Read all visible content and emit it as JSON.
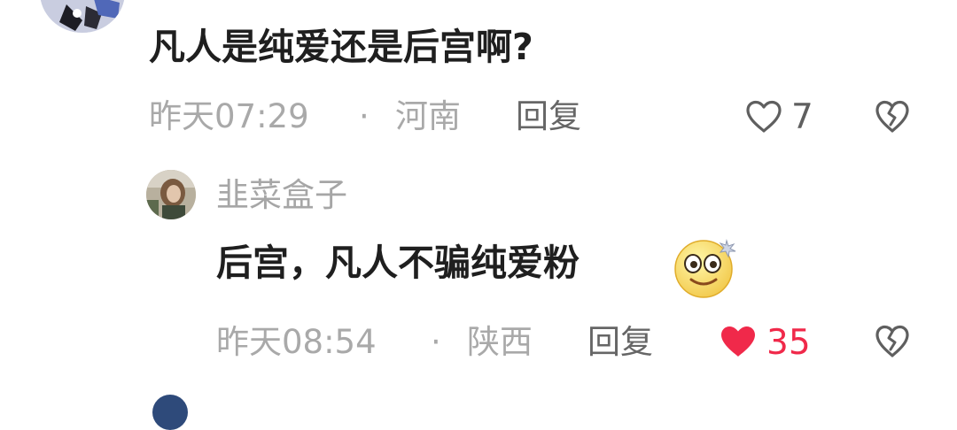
{
  "comment": {
    "text": "凡人是纯爱还是后宫啊?",
    "time": "昨天07:29",
    "separator": "·",
    "location": "河南",
    "reply_label": "回复",
    "like_count": "7",
    "liked": false
  },
  "reply": {
    "username": "韭菜盒子",
    "text": "后宫，凡人不骗纯爱粉",
    "emoji": "smiley-emoji",
    "time": "昨天08:54",
    "separator": "·",
    "location": "陕西",
    "reply_label": "回复",
    "like_count": "35",
    "liked": true
  },
  "colors": {
    "liked_red": "#f0294a",
    "icon_gray": "#5f5f5f",
    "meta_gray": "#a9a9a9",
    "text_dark": "#1f1f1f"
  },
  "icons": {
    "like": "heart-outline-icon",
    "liked": "heart-filled-icon",
    "dislike": "broken-heart-icon"
  }
}
